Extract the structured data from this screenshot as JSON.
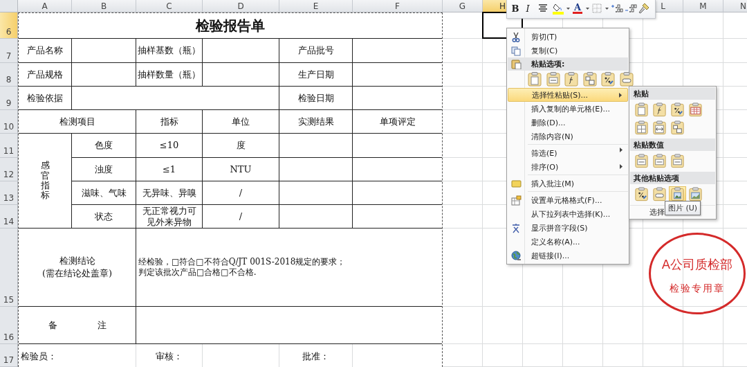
{
  "sheet": {
    "columns": [
      {
        "label": "A",
        "selected": false
      },
      {
        "label": "B",
        "selected": false
      },
      {
        "label": "C",
        "selected": false
      },
      {
        "label": "D",
        "selected": false
      },
      {
        "label": "E",
        "selected": false
      },
      {
        "label": "F",
        "selected": false
      },
      {
        "label": "G",
        "selected": false
      },
      {
        "label": "H",
        "selected": true
      },
      {
        "label": "L",
        "selected": false
      },
      {
        "label": "M",
        "selected": false
      },
      {
        "label": "N",
        "selected": false
      }
    ],
    "rows": [
      {
        "label": "6",
        "selected": true
      },
      {
        "label": "7",
        "selected": false
      },
      {
        "label": "8",
        "selected": false
      },
      {
        "label": "9",
        "selected": false
      },
      {
        "label": "10",
        "selected": false
      },
      {
        "label": "11",
        "selected": false
      },
      {
        "label": "12",
        "selected": false
      },
      {
        "label": "13",
        "selected": false
      },
      {
        "label": "14",
        "selected": false
      },
      {
        "label": "15",
        "selected": false
      },
      {
        "label": "16",
        "selected": false
      },
      {
        "label": "17",
        "selected": false
      }
    ]
  },
  "report": {
    "title": "检验报告单",
    "info": [
      "产品名称",
      "抽样基数（瓶）",
      "产品批号",
      "产品规格",
      "抽样数量（瓶）",
      "生产日期",
      "检验依据",
      "检验日期"
    ],
    "columns": [
      "检测项目",
      "指标",
      "单位",
      "实测结果",
      "单项评定"
    ],
    "group": "感官指标",
    "items": [
      {
        "name": "色度",
        "spec": "≤10",
        "unit": "度"
      },
      {
        "name": "浊度",
        "spec": "≤1",
        "unit": "NTU"
      },
      {
        "name": "滋味、气味",
        "spec": "无异味、异嗅",
        "unit": "/"
      },
      {
        "name": "状态",
        "spec": "无正常视力可见外来异物",
        "unit": "/"
      }
    ],
    "conclusion_label": [
      "检测结论",
      "(需在结论处盖章)"
    ],
    "conclusion_text": [
      "经检验，□符合□不符合Q/JT 001S-2018规定的要求；",
      "判定该批次产品□合格□不合格."
    ],
    "remarks_label": [
      "备",
      "注"
    ],
    "signatures": [
      "检验员：",
      "审核：",
      "批准："
    ]
  },
  "mini_toolbar": {
    "buttons": [
      {
        "kind": "bold",
        "text": "B"
      },
      {
        "kind": "italic",
        "text": "I"
      },
      {
        "kind": "center"
      },
      {
        "kind": "fill-color",
        "color": "#ffff00"
      },
      {
        "kind": "font-color",
        "text": "A",
        "color": "#e02020"
      },
      {
        "kind": "borders"
      },
      {
        "kind": "increase-decimal"
      },
      {
        "kind": "decrease-decimal"
      },
      {
        "kind": "format-painter"
      }
    ]
  },
  "context_menu": {
    "items": [
      {
        "kind": "item",
        "label": "剪切(T)",
        "selected": false,
        "submenu": false,
        "separator_above": false
      },
      {
        "kind": "item",
        "label": "复制(C)",
        "selected": false,
        "submenu": false,
        "separator_above": false
      },
      {
        "kind": "header",
        "label": "粘贴选项:"
      },
      {
        "kind": "paste-icons"
      },
      {
        "kind": "item",
        "label": "选择性粘贴(S)...",
        "selected": true,
        "submenu": true,
        "separator_above": false
      },
      {
        "kind": "item",
        "label": "插入复制的单元格(E)...",
        "selected": false,
        "submenu": false,
        "separator_above": false
      },
      {
        "kind": "item",
        "label": "删除(D)...",
        "selected": false,
        "submenu": false,
        "separator_above": false
      },
      {
        "kind": "item",
        "label": "清除内容(N)",
        "selected": false,
        "submenu": false,
        "separator_above": false
      },
      {
        "kind": "item",
        "label": "筛选(E)",
        "selected": false,
        "submenu": true,
        "separator_above": true
      },
      {
        "kind": "item",
        "label": "排序(O)",
        "selected": false,
        "submenu": true,
        "separator_above": false
      },
      {
        "kind": "item",
        "label": "插入批注(M)",
        "selected": false,
        "submenu": false,
        "separator_above": true
      },
      {
        "kind": "item",
        "label": "设置单元格格式(F)...",
        "selected": false,
        "submenu": false,
        "separator_above": true
      },
      {
        "kind": "item",
        "label": "从下拉列表中选择(K)...",
        "selected": false,
        "submenu": false,
        "separator_above": false
      },
      {
        "kind": "item",
        "label": "显示拼音字段(S)",
        "selected": false,
        "submenu": false,
        "separator_above": false
      },
      {
        "kind": "item",
        "label": "定义名称(A)...",
        "selected": false,
        "submenu": false,
        "separator_above": false
      },
      {
        "kind": "item",
        "label": "超链接(I)...",
        "selected": false,
        "submenu": false,
        "separator_above": false
      }
    ]
  },
  "paste_submenu": {
    "sections": [
      {
        "header": "粘贴",
        "buttons": [
          {
            "selected": false
          },
          {
            "selected": false
          },
          {
            "selected": false
          },
          {
            "selected": false
          },
          {
            "selected": false
          },
          {
            "selected": false
          },
          {
            "selected": false
          }
        ]
      },
      {
        "header": "粘贴数值",
        "buttons": [
          {
            "selected": false
          },
          {
            "selected": false
          },
          {
            "selected": false
          }
        ]
      },
      {
        "header": "其他粘贴选项",
        "buttons": [
          {
            "selected": false
          },
          {
            "selected": false
          },
          {
            "selected": true
          },
          {
            "selected": false
          }
        ]
      }
    ],
    "footer": "选择"
  },
  "tooltip": "图片 (U)",
  "stamp": {
    "lines": [
      "A公司质检部",
      "检验专用章"
    ],
    "color": "#d42a2a"
  }
}
